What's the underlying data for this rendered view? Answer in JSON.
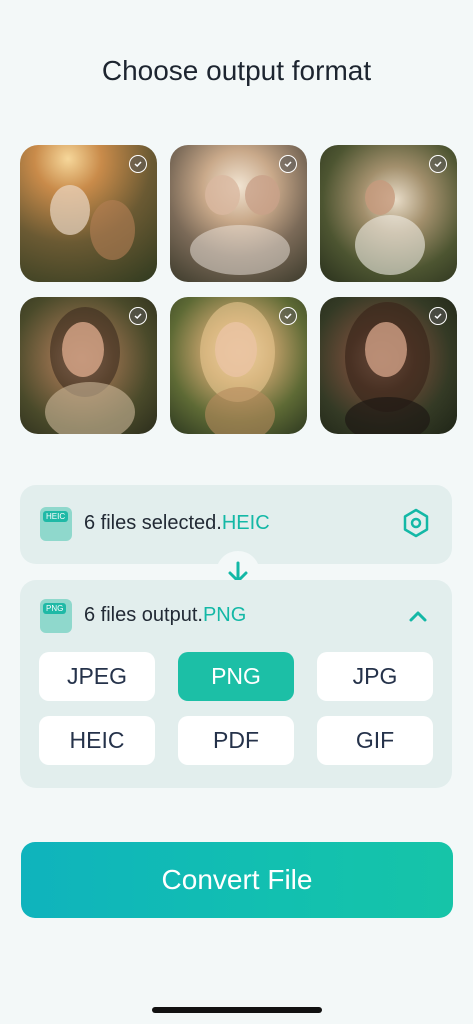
{
  "header": {
    "title": "Choose output format"
  },
  "photos": [
    {
      "name": "family-photo-1",
      "selected": true
    },
    {
      "name": "family-photo-2",
      "selected": true
    },
    {
      "name": "family-photo-3",
      "selected": true
    },
    {
      "name": "portrait-photo-1",
      "selected": true
    },
    {
      "name": "portrait-photo-2",
      "selected": true
    },
    {
      "name": "portrait-photo-3",
      "selected": true
    }
  ],
  "input": {
    "icon_tag": "HEIC",
    "text": "6 files selected.",
    "format": "HEIC",
    "settings_icon": "hexagon-settings-icon"
  },
  "output": {
    "icon_tag": "PNG",
    "text": "6 files output.",
    "format": "PNG",
    "toggle_icon": "chevron-up-icon"
  },
  "formats": [
    "JPEG",
    "PNG",
    "JPG",
    "HEIC",
    "PDF",
    "GIF"
  ],
  "selected_format": "PNG",
  "convert": {
    "label": "Convert File"
  },
  "colors": {
    "accent": "#13b8a6",
    "active_button": "#1cbfa6",
    "background": "#f3f8f8"
  }
}
